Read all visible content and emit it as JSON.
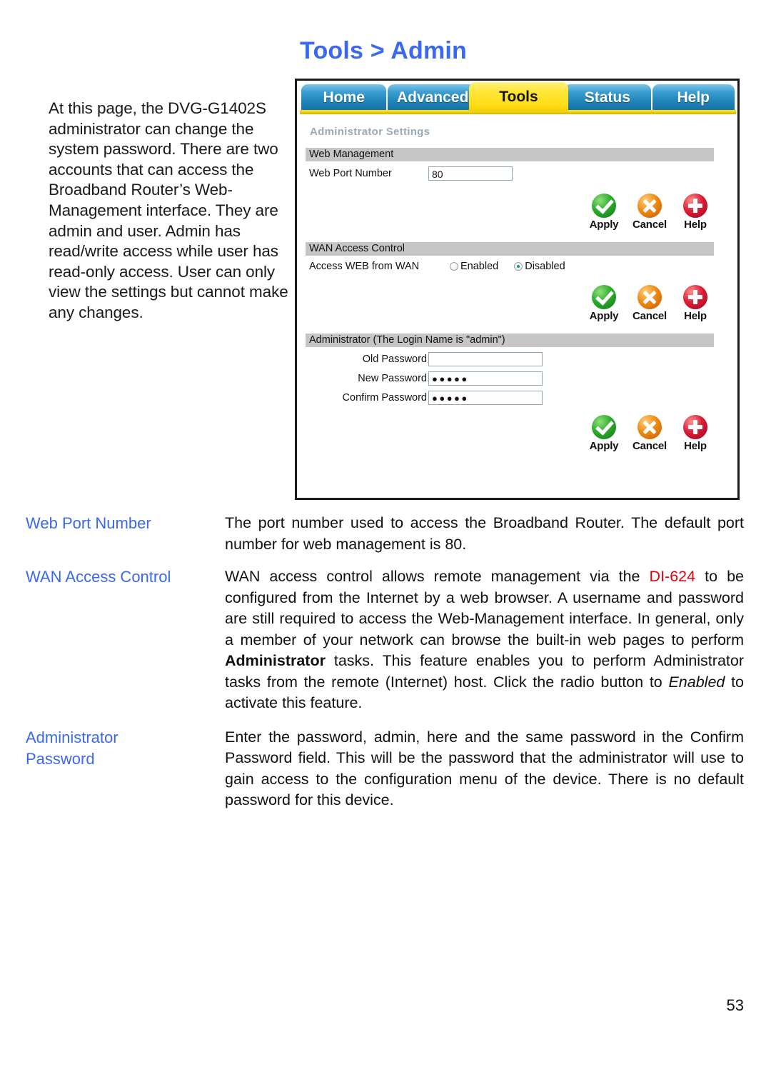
{
  "page": {
    "title": "Tools > Admin",
    "number": "53"
  },
  "intro": {
    "text": "At this page, the DVG-G1402S administrator can change the system password. There are two accounts that can access the Broadband Router’s Web-Management interface. They are admin and user. Admin has read/write access while user has read-only access. User can only view the settings but cannot make any changes."
  },
  "screenshot": {
    "tabs": [
      {
        "label": "Home",
        "active": false
      },
      {
        "label": "Advanced",
        "active": false
      },
      {
        "label": "Tools",
        "active": true
      },
      {
        "label": "Status",
        "active": false
      },
      {
        "label": "Help",
        "active": false
      }
    ],
    "heading": "Administrator Settings",
    "sections": [
      {
        "bar": "Web Management",
        "field_label": "Web Port Number",
        "field_value": "80"
      },
      {
        "bar": "WAN Access Control",
        "field_label": "Access WEB from WAN",
        "radios": [
          {
            "label": "Enabled",
            "selected": false
          },
          {
            "label": "Disabled",
            "selected": true
          }
        ]
      },
      {
        "bar": "Administrator (The Login Name is \"admin\")",
        "fields": [
          {
            "label": "Old Password",
            "value": ""
          },
          {
            "label": "New Password",
            "value": "●●●●●"
          },
          {
            "label": "Confirm Password",
            "value": "●●●●●"
          }
        ]
      }
    ],
    "actions": {
      "apply": "Apply",
      "cancel": "Cancel",
      "help": "Help"
    },
    "colors": {
      "tab_active": "#ffdf18",
      "tab_inactive": "#1d7fb5",
      "bar": "#c6c6c6",
      "apply": "#2eab2e",
      "cancel": "#ef8b14",
      "help": "#dc1f38"
    }
  },
  "definitions": [
    {
      "term": "Web Port Number",
      "desc_1": "The port number used to access the Broadband Router. The default port number for web management is 80."
    },
    {
      "term": "WAN Access Control",
      "desc_1": "WAN access control allows remote management via the ",
      "model": "DI-624",
      "desc_2": " to be configured from the Internet by a web browser. A username and password are still required to access the Web-Management interface. In general, only a member of your network can browse the built-in web pages to perform ",
      "bold_1": "Administrator",
      "desc_3": " tasks. This feature enables you to perform Administrator tasks from the remote (Internet) host. Click the radio button to ",
      "italic_1": "Enabled",
      "desc_4": " to activate this feature."
    },
    {
      "term_line_1": "Administrator",
      "term_line_2": "Password",
      "desc_1": " Enter the password, admin, here and the same password in the Confirm Password field. This will be the password that the administrator will use to gain access to the configuration menu of the device. There is no default password for this device."
    }
  ]
}
